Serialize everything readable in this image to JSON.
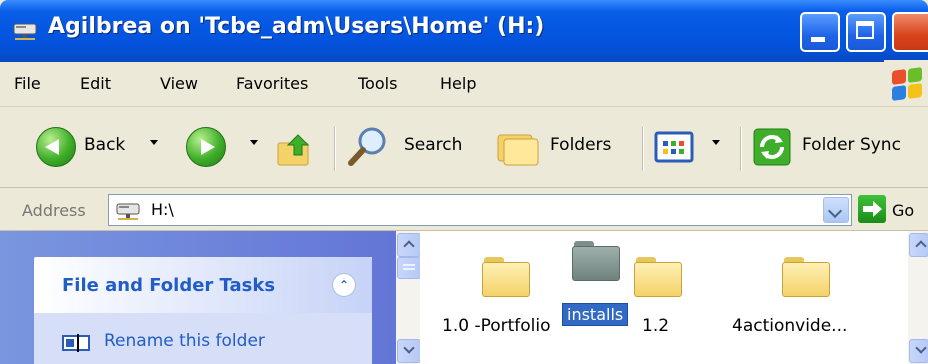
{
  "window": {
    "title": "Agilbrea on 'Tcbe_adm\\Users\\Home' (H:)",
    "icon": "network-drive-icon",
    "buttons": [
      "minimize",
      "maximize",
      "close"
    ]
  },
  "menu": {
    "items": [
      "File",
      "Edit",
      "View",
      "Favorites",
      "Tools",
      "Help"
    ]
  },
  "toolbar": {
    "back_label": "Back",
    "search_label": "Search",
    "folders_label": "Folders",
    "folder_sync_label": "Folder Sync"
  },
  "address": {
    "label": "Address",
    "value": "H:\\",
    "go_label": "Go"
  },
  "tasks": {
    "title": "File and Folder Tasks",
    "items": [
      {
        "label": "Rename this folder",
        "icon": "rename-icon"
      }
    ]
  },
  "files": {
    "items": [
      {
        "label": "1.0 -Portfolio"
      },
      {
        "label": "1.2"
      },
      {
        "label": "4actionvide..."
      }
    ],
    "dragging": {
      "label": "installs"
    }
  },
  "colors": {
    "titlebar": "#0451d8",
    "task_link": "#215dc6",
    "selection": "#316ac5"
  }
}
